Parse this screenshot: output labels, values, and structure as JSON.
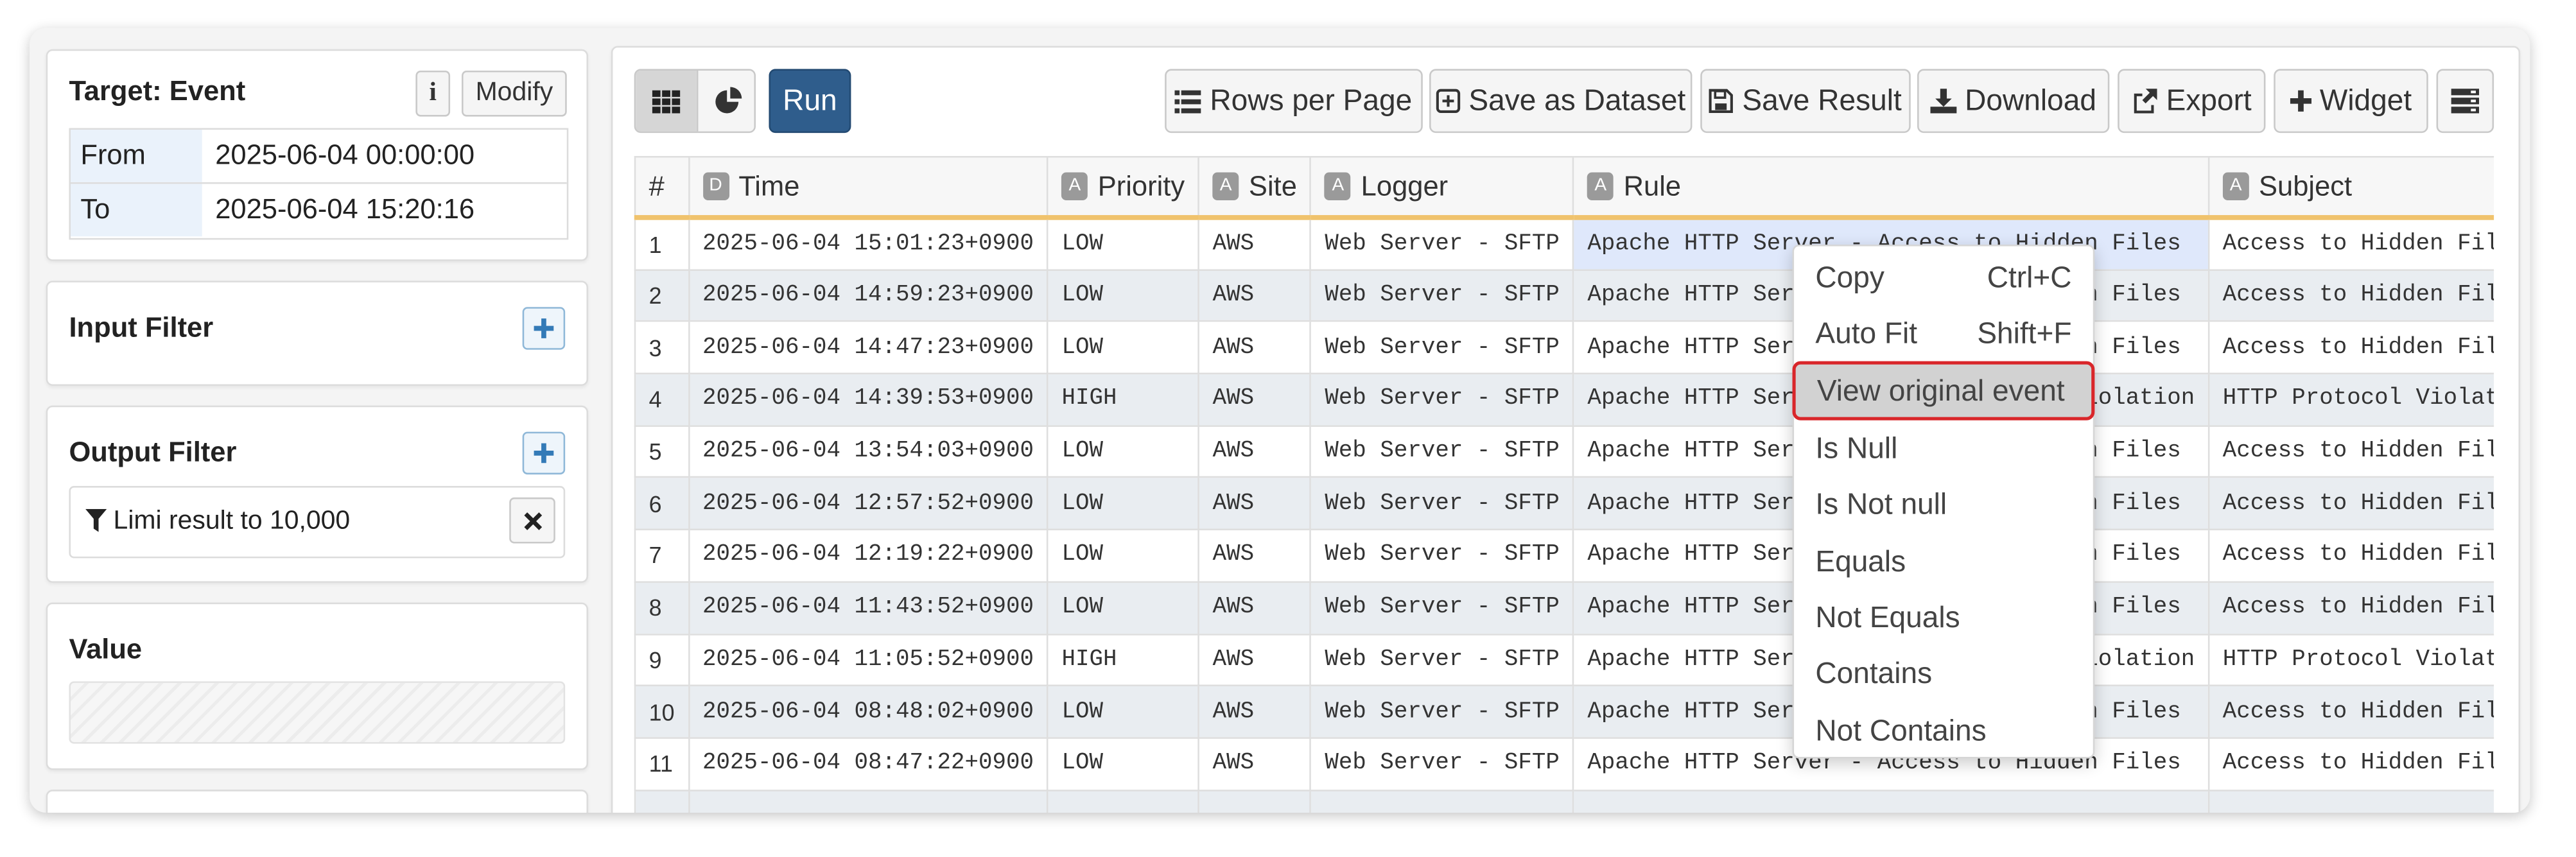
{
  "target": {
    "title": "Target: Event",
    "info_label": "i",
    "modify_label": "Modify"
  },
  "range": {
    "from_label": "From",
    "from_value": "2025-06-04 00:00:00",
    "to_label": "To",
    "to_value": "2025-06-04 15:20:16"
  },
  "input_filter": {
    "title": "Input Filter"
  },
  "output_filter": {
    "title": "Output Filter",
    "item": "Limi result to 10,000"
  },
  "value_panel": {
    "title": "Value"
  },
  "toolbar": {
    "run": "Run",
    "rows_per_page": "Rows per Page",
    "save_as_dataset": "Save as Dataset",
    "save_result": "Save Result",
    "download": "Download",
    "export": "Export",
    "widget": "Widget"
  },
  "table": {
    "columns": [
      {
        "label": "#",
        "type": ""
      },
      {
        "label": "Time",
        "type": "D"
      },
      {
        "label": "Priority",
        "type": "A"
      },
      {
        "label": "Site",
        "type": "A"
      },
      {
        "label": "Logger",
        "type": "A"
      },
      {
        "label": "Rule",
        "type": "A"
      },
      {
        "label": "Subject",
        "type": "A"
      }
    ],
    "rows": [
      [
        "1",
        "2025-06-04 15:01:23+0900",
        "LOW",
        "AWS",
        "Web Server - SFTP",
        "Apache HTTP Server - Access to Hidden Files",
        "Access to Hidden Files"
      ],
      [
        "2",
        "2025-06-04 14:59:23+0900",
        "LOW",
        "AWS",
        "Web Server - SFTP",
        "Apache HTTP Server - Access to Hidden Files",
        "Access to Hidden Files"
      ],
      [
        "3",
        "2025-06-04 14:47:23+0900",
        "LOW",
        "AWS",
        "Web Server - SFTP",
        "Apache HTTP Server - Access to Hidden Files",
        "Access to Hidden Files"
      ],
      [
        "4",
        "2025-06-04 14:39:53+0900",
        "HIGH",
        "AWS",
        "Web Server - SFTP",
        "Apache HTTP Server - HTTP Protocol Violation",
        "HTTP Protocol Violation"
      ],
      [
        "5",
        "2025-06-04 13:54:03+0900",
        "LOW",
        "AWS",
        "Web Server - SFTP",
        "Apache HTTP Server - Access to Hidden Files",
        "Access to Hidden Files"
      ],
      [
        "6",
        "2025-06-04 12:57:52+0900",
        "LOW",
        "AWS",
        "Web Server - SFTP",
        "Apache HTTP Server - Access to Hidden Files",
        "Access to Hidden Files"
      ],
      [
        "7",
        "2025-06-04 12:19:22+0900",
        "LOW",
        "AWS",
        "Web Server - SFTP",
        "Apache HTTP Server - Access to Hidden Files",
        "Access to Hidden Files"
      ],
      [
        "8",
        "2025-06-04 11:43:52+0900",
        "LOW",
        "AWS",
        "Web Server - SFTP",
        "Apache HTTP Server - Access to Hidden Files",
        "Access to Hidden Files"
      ],
      [
        "9",
        "2025-06-04 11:05:52+0900",
        "HIGH",
        "AWS",
        "Web Server - SFTP",
        "Apache HTTP Server - HTTP Protocol Violation",
        "HTTP Protocol Violation"
      ],
      [
        "10",
        "2025-06-04 08:48:02+0900",
        "LOW",
        "AWS",
        "Web Server - SFTP",
        "Apache HTTP Server - Access to Hidden Files",
        "Access to Hidden Files"
      ],
      [
        "11",
        "2025-06-04 08:47:22+0900",
        "LOW",
        "AWS",
        "Web Server - SFTP",
        "Apache HTTP Server - Access to Hidden Files",
        "Access to Hidden Files"
      ],
      [
        "",
        "",
        "",
        "",
        "",
        "",
        ""
      ]
    ]
  },
  "context_menu": {
    "items": [
      {
        "label": "Copy",
        "shortcut": "Ctrl+C"
      },
      {
        "label": "Auto Fit",
        "shortcut": "Shift+F"
      },
      {
        "label": "View original event",
        "shortcut": ""
      },
      {
        "label": "Is Null",
        "shortcut": ""
      },
      {
        "label": "Is Not null",
        "shortcut": ""
      },
      {
        "label": "Equals",
        "shortcut": ""
      },
      {
        "label": "Not Equals",
        "shortcut": ""
      },
      {
        "label": "Contains",
        "shortcut": ""
      },
      {
        "label": "Not Contains",
        "shortcut": ""
      }
    ]
  },
  "colors": {
    "run": "#2f5d8c",
    "accent": "#337ab7",
    "highlight_border": "#d9262a",
    "header_underline": "#f0c36d"
  },
  "icons": [
    "grid-icon",
    "pie-chart-icon",
    "list-icon",
    "plus-square-icon",
    "floppy-icon",
    "download-icon",
    "export-icon",
    "plus-icon",
    "layout-icon",
    "filter-icon",
    "close-icon"
  ]
}
